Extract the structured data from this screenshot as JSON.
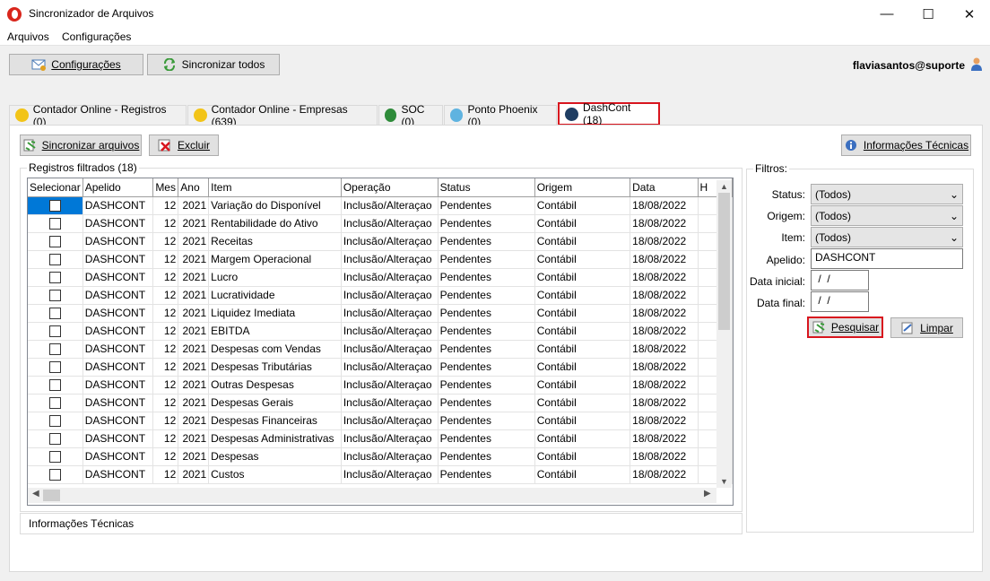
{
  "window": {
    "title": "Sincronizador de Arquivos",
    "controls": {
      "minimize": "—",
      "maximize": "☐",
      "close": "✕"
    }
  },
  "menu": [
    "Arquivos",
    "Configurações"
  ],
  "toolbar": {
    "config_label": "Configurações",
    "sync_all_label": "Sincronizar todos",
    "user": "flaviasantos@suporte"
  },
  "tabs": [
    {
      "label": "Contador Online - Registros (0)",
      "icon": "yellow-face-icon"
    },
    {
      "label": "Contador Online - Empresas (639)",
      "icon": "yellow-face-icon"
    },
    {
      "label": "SOC (0)",
      "icon": "soc-icon"
    },
    {
      "label": "Ponto Phoenix (0)",
      "icon": "phoenix-icon"
    },
    {
      "label": "DashCont (18)",
      "icon": "dashcont-icon"
    }
  ],
  "actions": {
    "sync_files_label": "Sincronizar arquivos",
    "delete_label": "Excluir",
    "tech_info_label": "Informações Técnicas"
  },
  "records": {
    "group_label": "Registros filtrados (18)",
    "columns": [
      "Selecionar",
      "Apelido",
      "Mes",
      "Ano",
      "Item",
      "Operação",
      "Status",
      "Origem",
      "Data",
      "H"
    ],
    "rows": [
      [
        "DASHCONT",
        "12",
        "2021",
        "Variação do Disponível",
        "Inclusão/Alteraçao",
        "Pendentes",
        "Contábil",
        "18/08/2022"
      ],
      [
        "DASHCONT",
        "12",
        "2021",
        "Rentabilidade do Ativo",
        "Inclusão/Alteraçao",
        "Pendentes",
        "Contábil",
        "18/08/2022"
      ],
      [
        "DASHCONT",
        "12",
        "2021",
        "Receitas",
        "Inclusão/Alteraçao",
        "Pendentes",
        "Contábil",
        "18/08/2022"
      ],
      [
        "DASHCONT",
        "12",
        "2021",
        "Margem Operacional",
        "Inclusão/Alteraçao",
        "Pendentes",
        "Contábil",
        "18/08/2022"
      ],
      [
        "DASHCONT",
        "12",
        "2021",
        "Lucro",
        "Inclusão/Alteraçao",
        "Pendentes",
        "Contábil",
        "18/08/2022"
      ],
      [
        "DASHCONT",
        "12",
        "2021",
        "Lucratividade",
        "Inclusão/Alteraçao",
        "Pendentes",
        "Contábil",
        "18/08/2022"
      ],
      [
        "DASHCONT",
        "12",
        "2021",
        "Liquidez Imediata",
        "Inclusão/Alteraçao",
        "Pendentes",
        "Contábil",
        "18/08/2022"
      ],
      [
        "DASHCONT",
        "12",
        "2021",
        "EBITDA",
        "Inclusão/Alteraçao",
        "Pendentes",
        "Contábil",
        "18/08/2022"
      ],
      [
        "DASHCONT",
        "12",
        "2021",
        "Despesas com Vendas",
        "Inclusão/Alteraçao",
        "Pendentes",
        "Contábil",
        "18/08/2022"
      ],
      [
        "DASHCONT",
        "12",
        "2021",
        "Despesas Tributárias",
        "Inclusão/Alteraçao",
        "Pendentes",
        "Contábil",
        "18/08/2022"
      ],
      [
        "DASHCONT",
        "12",
        "2021",
        "Outras Despesas",
        "Inclusão/Alteraçao",
        "Pendentes",
        "Contábil",
        "18/08/2022"
      ],
      [
        "DASHCONT",
        "12",
        "2021",
        "Despesas Gerais",
        "Inclusão/Alteraçao",
        "Pendentes",
        "Contábil",
        "18/08/2022"
      ],
      [
        "DASHCONT",
        "12",
        "2021",
        "Despesas Financeiras",
        "Inclusão/Alteraçao",
        "Pendentes",
        "Contábil",
        "18/08/2022"
      ],
      [
        "DASHCONT",
        "12",
        "2021",
        "Despesas Administrativas",
        "Inclusão/Alteraçao",
        "Pendentes",
        "Contábil",
        "18/08/2022"
      ],
      [
        "DASHCONT",
        "12",
        "2021",
        "Despesas",
        "Inclusão/Alteraçao",
        "Pendentes",
        "Contábil",
        "18/08/2022"
      ],
      [
        "DASHCONT",
        "12",
        "2021",
        "Custos",
        "Inclusão/Alteraçao",
        "Pendentes",
        "Contábil",
        "18/08/2022"
      ]
    ]
  },
  "bottom_info_label": "Informações Técnicas",
  "filters": {
    "group_label": "Filtros:",
    "status_label": "Status:",
    "status_value": "(Todos)",
    "origem_label": "Origem:",
    "origem_value": "(Todos)",
    "item_label": "Item:",
    "item_value": "(Todos)",
    "apelido_label": "Apelido:",
    "apelido_value": "DASHCONT",
    "data_inicial_label": "Data inicial:",
    "data_inicial_value": " /  /",
    "data_final_label": "Data final:",
    "data_final_value": " /  /",
    "search_label": "Pesquisar",
    "clear_label": "Limpar"
  },
  "colors": {
    "highlight": "#d8151e",
    "selection": "#0078d7"
  }
}
